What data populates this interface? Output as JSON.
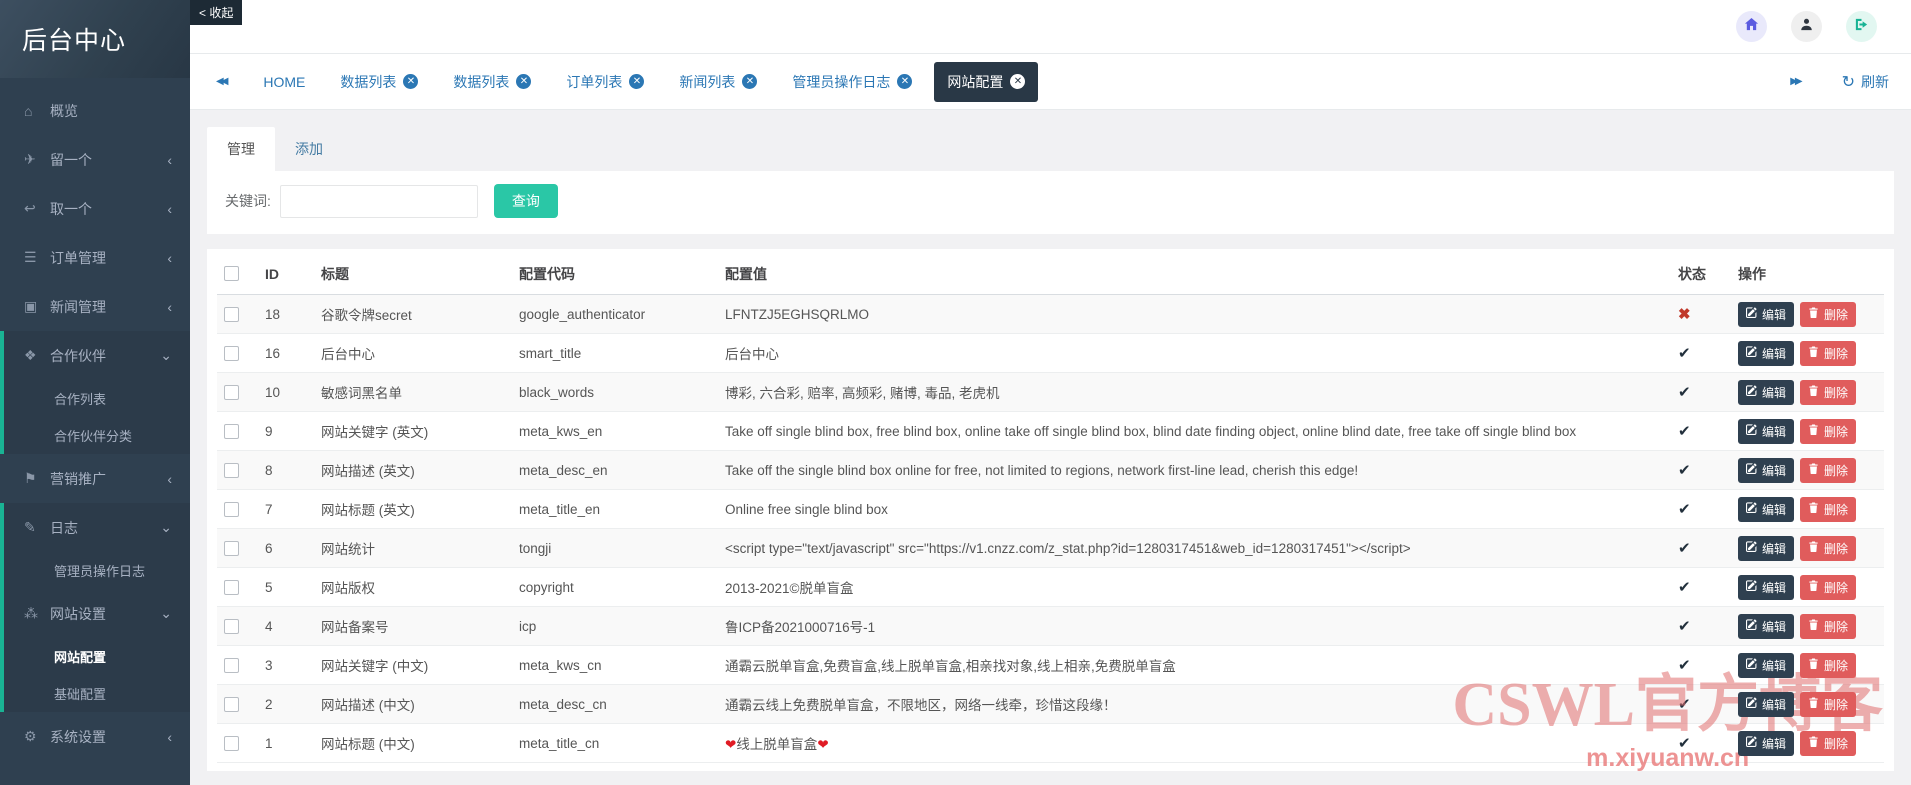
{
  "app": {
    "title": "后台中心",
    "collapse_label": "< 收起"
  },
  "sidebar": {
    "items": [
      {
        "key": "overview",
        "label": "概览",
        "icon": "home-icon",
        "glyph": "⌂",
        "chevron": null,
        "expanded": false,
        "children": []
      },
      {
        "key": "leave-one",
        "label": "留一个",
        "icon": "paper-plane-icon",
        "glyph": "✈",
        "chevron": "left",
        "expanded": false,
        "children": []
      },
      {
        "key": "take-one",
        "label": "取一个",
        "icon": "share-icon",
        "glyph": "↩",
        "chevron": "left",
        "expanded": false,
        "children": []
      },
      {
        "key": "orders",
        "label": "订单管理",
        "icon": "list-icon",
        "glyph": "☰",
        "chevron": "left",
        "expanded": false,
        "children": []
      },
      {
        "key": "news",
        "label": "新闻管理",
        "icon": "newspaper-icon",
        "glyph": "▣",
        "chevron": "left",
        "expanded": false,
        "children": []
      },
      {
        "key": "partners",
        "label": "合作伙伴",
        "icon": "handshake-icon",
        "glyph": "❖",
        "chevron": "down",
        "expanded": true,
        "children": [
          {
            "label": "合作列表",
            "active": false
          },
          {
            "label": "合作伙伴分类",
            "active": false
          }
        ]
      },
      {
        "key": "marketing",
        "label": "营销推广",
        "icon": "bullhorn-icon",
        "glyph": "⚑",
        "chevron": "left",
        "expanded": false,
        "children": []
      },
      {
        "key": "logs",
        "label": "日志",
        "icon": "edit-icon",
        "glyph": "✎",
        "chevron": "down",
        "expanded": true,
        "children": [
          {
            "label": "管理员操作日志",
            "active": false
          }
        ]
      },
      {
        "key": "site-settings",
        "label": "网站设置",
        "icon": "sitemap-icon",
        "glyph": "⁂",
        "chevron": "down",
        "expanded": true,
        "children": [
          {
            "label": "网站配置",
            "active": true
          },
          {
            "label": "基础配置",
            "active": false
          }
        ]
      },
      {
        "key": "system-settings",
        "label": "系统设置",
        "icon": "gear-icon",
        "glyph": "⚙",
        "chevron": "left",
        "expanded": false,
        "children": []
      }
    ]
  },
  "topbar": {
    "icons": [
      "home-icon",
      "user-icon",
      "logout-icon"
    ]
  },
  "tabbar": {
    "refresh_label": "刷新",
    "tabs": [
      {
        "label": "HOME",
        "closable": false,
        "active": false
      },
      {
        "label": "数据列表",
        "closable": true,
        "active": false
      },
      {
        "label": "数据列表",
        "closable": true,
        "active": false
      },
      {
        "label": "订单列表",
        "closable": true,
        "active": false
      },
      {
        "label": "新闻列表",
        "closable": true,
        "active": false
      },
      {
        "label": "管理员操作日志",
        "closable": true,
        "active": false
      },
      {
        "label": "网站配置",
        "closable": true,
        "active": true
      }
    ]
  },
  "panel": {
    "tabs": [
      {
        "label": "管理",
        "active": true
      },
      {
        "label": "添加",
        "active": false
      }
    ],
    "search": {
      "label": "关键词:",
      "value": "",
      "button_label": "查询"
    }
  },
  "table": {
    "headers": {
      "id": "ID",
      "title": "标题",
      "code": "配置代码",
      "value": "配置值",
      "status": "状态",
      "actions": "操作"
    },
    "edit_label": "编辑",
    "delete_label": "删除",
    "rows": [
      {
        "id": "18",
        "title": "谷歌令牌secret",
        "code": "google_authenticator",
        "value": "LFNTZJ5EGHSQRLMO",
        "status": "off"
      },
      {
        "id": "16",
        "title": "后台中心",
        "code": "smart_title",
        "value": "后台中心",
        "status": "on"
      },
      {
        "id": "10",
        "title": "敏感词黑名单",
        "code": "black_words",
        "value": "博彩, 六合彩, 赔率, 高频彩, 赌博, 毒品, 老虎机",
        "status": "on"
      },
      {
        "id": "9",
        "title": "网站关键字 (英文)",
        "code": "meta_kws_en",
        "value": "Take off single blind box, free blind box, online take off single blind box, blind date finding object, online blind date, free take off single blind box",
        "status": "on"
      },
      {
        "id": "8",
        "title": "网站描述 (英文)",
        "code": "meta_desc_en",
        "value": "Take off the single blind box online for free, not limited to regions, network first-line lead, cherish this edge!",
        "status": "on"
      },
      {
        "id": "7",
        "title": "网站标题 (英文)",
        "code": "meta_title_en",
        "value": "Online free single blind box",
        "status": "on"
      },
      {
        "id": "6",
        "title": "网站统计",
        "code": "tongji",
        "value": "<script type=\"text/javascript\" src=\"https://v1.cnzz.com/z_stat.php?id=1280317451&web_id=1280317451\"></script>",
        "status": "on"
      },
      {
        "id": "5",
        "title": "网站版权",
        "code": "copyright",
        "value": "2013-2021©脱单盲盒",
        "status": "on"
      },
      {
        "id": "4",
        "title": "网站备案号",
        "code": "icp",
        "value": "鲁ICP备2021000716号-1",
        "status": "on"
      },
      {
        "id": "3",
        "title": "网站关键字 (中文)",
        "code": "meta_kws_cn",
        "value": "通霸云脱单盲盒,免费盲盒,线上脱单盲盒,相亲找对象,线上相亲,免费脱单盲盒",
        "status": "on"
      },
      {
        "id": "2",
        "title": "网站描述 (中文)",
        "code": "meta_desc_cn",
        "value": "通霸云线上免费脱单盲盒，不限地区，网络一线牵，珍惜这段缘！",
        "status": "on"
      },
      {
        "id": "1",
        "title": "网站标题 (中文)",
        "code": "meta_title_cn",
        "value": "❤线上脱单盲盒❤",
        "status": "on"
      }
    ]
  },
  "watermark": {
    "line1": "CSWL官方博客",
    "line2": "m.xiyuanw.cn"
  },
  "colors": {
    "accent_teal": "#1ab394",
    "button_teal": "#2ac7a6",
    "link_blue": "#2b77b4",
    "dark_navy": "#2f4050",
    "danger_red": "#e05c5c",
    "status_off_red": "#c0392b"
  }
}
